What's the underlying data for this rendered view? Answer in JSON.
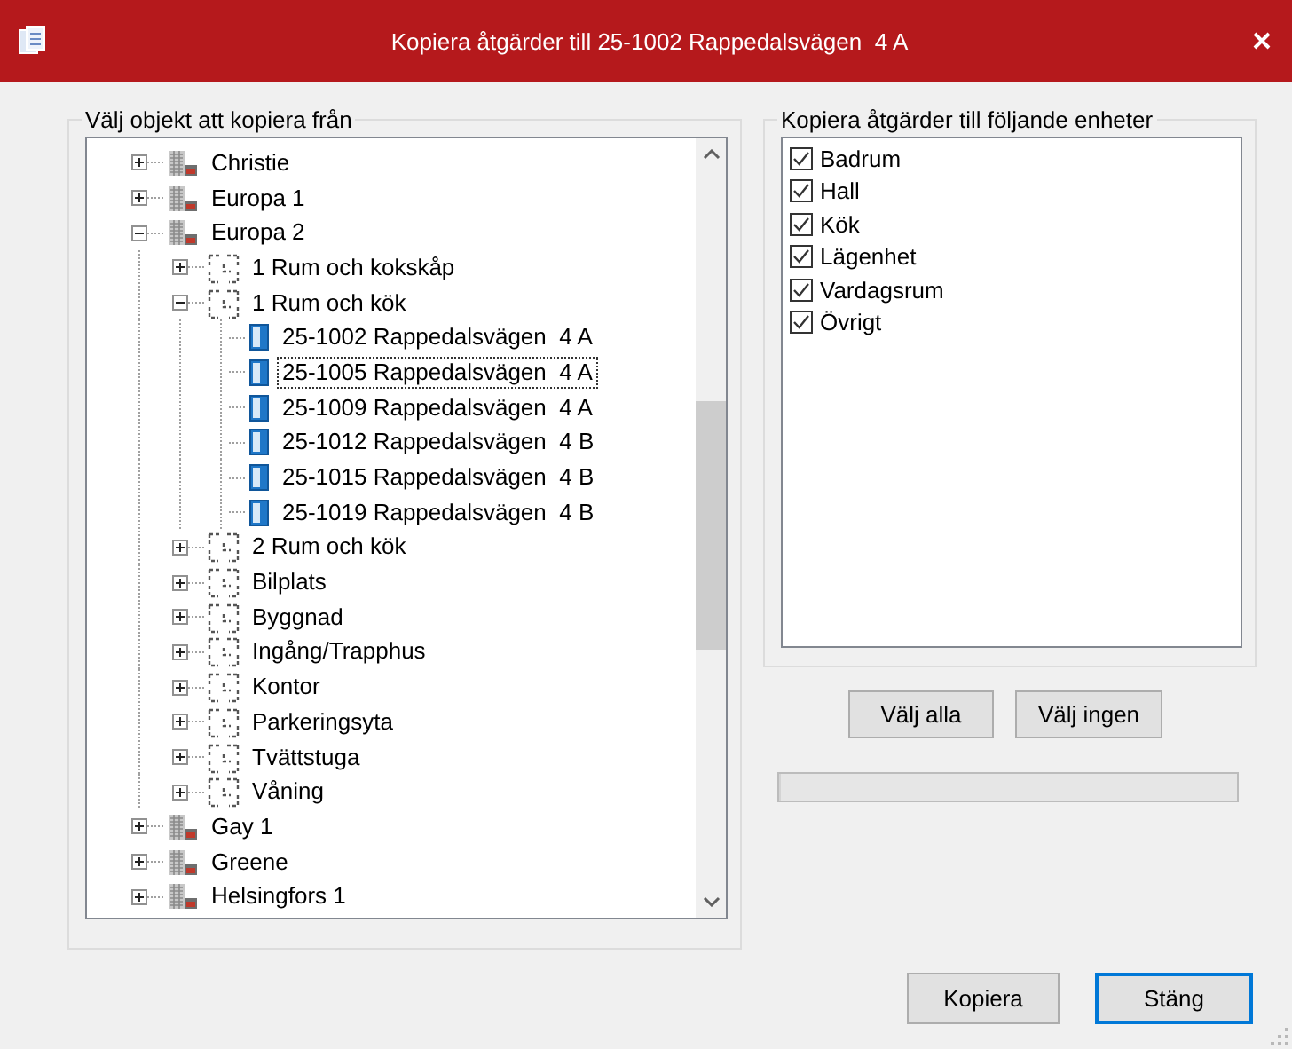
{
  "window": {
    "title": "Kopiera åtgärder till 25-1002 Rappedalsvägen  4 A"
  },
  "source": {
    "title": "Välj objekt att kopiera från",
    "tree": [
      {
        "label": "Christie",
        "kind": "building",
        "expanded": false,
        "selected": false
      },
      {
        "label": "Europa 1",
        "kind": "building",
        "expanded": false,
        "selected": false
      },
      {
        "label": "Europa 2",
        "kind": "building",
        "expanded": true,
        "selected": false,
        "children": [
          {
            "label": "1 Rum och kokskåp",
            "kind": "group",
            "expanded": false,
            "selected": false
          },
          {
            "label": "1 Rum och kök",
            "kind": "group",
            "expanded": true,
            "selected": false,
            "children": [
              {
                "label": "25-1002 Rappedalsvägen  4 A",
                "kind": "unit",
                "selected": false
              },
              {
                "label": "25-1005 Rappedalsvägen  4 A",
                "kind": "unit",
                "selected": true
              },
              {
                "label": "25-1009 Rappedalsvägen  4 A",
                "kind": "unit",
                "selected": false
              },
              {
                "label": "25-1012 Rappedalsvägen  4 B",
                "kind": "unit",
                "selected": false
              },
              {
                "label": "25-1015 Rappedalsvägen  4 B",
                "kind": "unit",
                "selected": false
              },
              {
                "label": "25-1019 Rappedalsvägen  4 B",
                "kind": "unit",
                "selected": false
              }
            ]
          },
          {
            "label": "2 Rum och kök",
            "kind": "group",
            "expanded": false,
            "selected": false
          },
          {
            "label": "Bilplats",
            "kind": "group",
            "expanded": false,
            "selected": false
          },
          {
            "label": "Byggnad",
            "kind": "group",
            "expanded": false,
            "selected": false
          },
          {
            "label": "Ingång/Trapphus",
            "kind": "group",
            "expanded": false,
            "selected": false
          },
          {
            "label": "Kontor",
            "kind": "group",
            "expanded": false,
            "selected": false
          },
          {
            "label": "Parkeringsyta",
            "kind": "group",
            "expanded": false,
            "selected": false
          },
          {
            "label": "Tvättstuga",
            "kind": "group",
            "expanded": false,
            "selected": false
          },
          {
            "label": "Våning",
            "kind": "group",
            "expanded": false,
            "selected": false
          }
        ]
      },
      {
        "label": "Gay 1",
        "kind": "building",
        "expanded": false,
        "selected": false
      },
      {
        "label": "Greene",
        "kind": "building",
        "expanded": false,
        "selected": false
      },
      {
        "label": "Helsingfors 1",
        "kind": "building",
        "expanded": false,
        "selected": false
      }
    ]
  },
  "target": {
    "title": "Kopiera åtgärder till följande enheter",
    "items": [
      {
        "label": "Badrum",
        "checked": true
      },
      {
        "label": "Hall",
        "checked": true
      },
      {
        "label": "Kök",
        "checked": true
      },
      {
        "label": "Lägenhet",
        "checked": true
      },
      {
        "label": "Vardagsrum",
        "checked": true
      },
      {
        "label": "Övrigt",
        "checked": true
      }
    ]
  },
  "select_buttons": [
    "Välj alla",
    "Välj ingen"
  ],
  "progress": {
    "level": 0
  },
  "buttons": [
    {
      "label": "Kopiera",
      "default": false
    },
    {
      "label": "Stäng",
      "default": true
    }
  ]
}
